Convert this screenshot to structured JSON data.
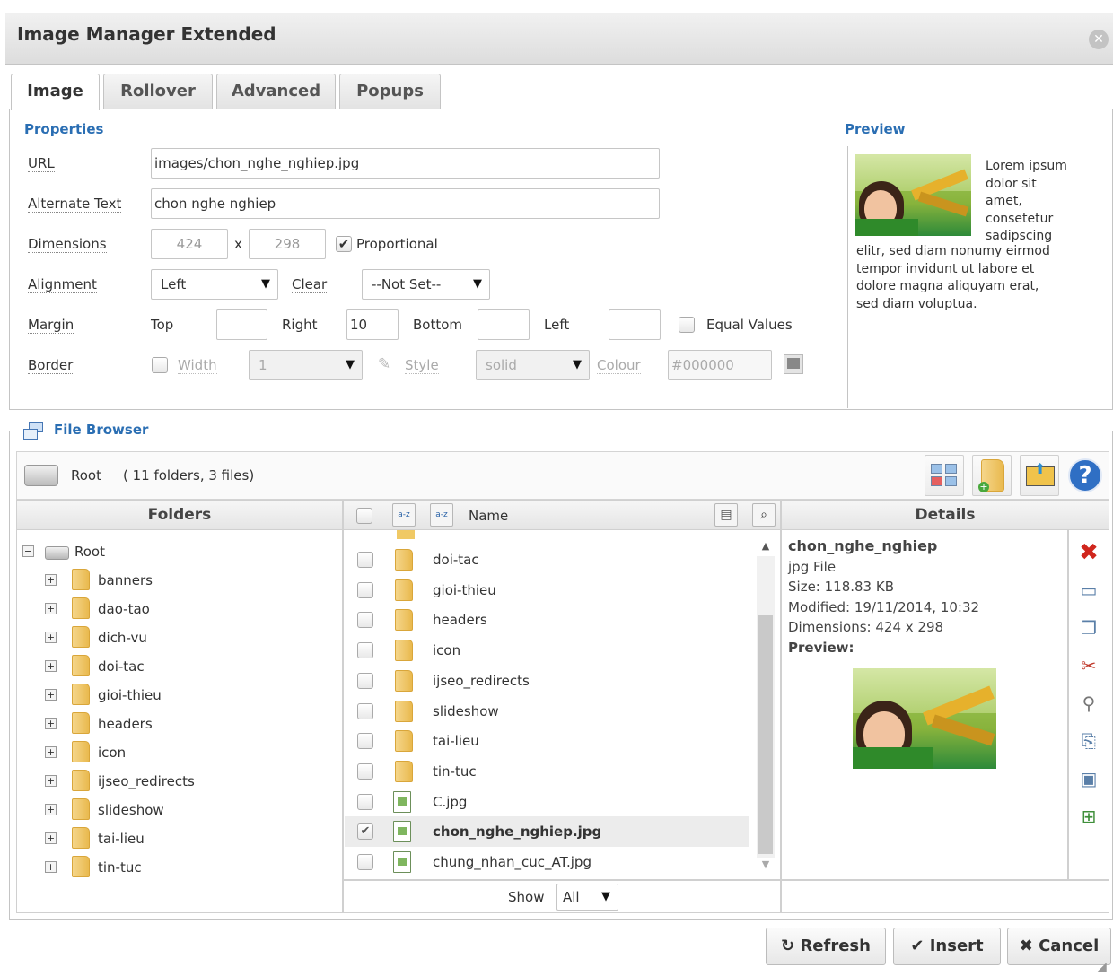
{
  "window": {
    "title": "Image Manager Extended"
  },
  "tabs": [
    "Image",
    "Rollover",
    "Advanced",
    "Popups"
  ],
  "properties": {
    "section_title": "Properties",
    "url_label": "URL",
    "url_value": "images/chon_nghe_nghiep.jpg",
    "alt_label": "Alternate Text",
    "alt_value": "chon nghe nghiep",
    "dimensions_label": "Dimensions",
    "width_value": "424",
    "times_sign": "x",
    "height_value": "298",
    "proportional_label": "Proportional",
    "alignment_label": "Alignment",
    "alignment_value": "Left",
    "clear_label": "Clear",
    "clear_value": "--Not Set--",
    "margin_label": "Margin",
    "margin_top_label": "Top",
    "margin_top_value": "",
    "margin_right_label": "Right",
    "margin_right_value": "10",
    "margin_bottom_label": "Bottom",
    "margin_bottom_value": "",
    "margin_left_label": "Left",
    "margin_left_value": "",
    "equal_values_label": "Equal Values",
    "border_label": "Border",
    "border_width_label": "Width",
    "border_width_value": "1",
    "border_style_label": "Style",
    "border_style_value": "solid",
    "border_colour_label": "Colour",
    "border_colour_value": "#000000"
  },
  "preview": {
    "section_title": "Preview",
    "lorem_short": [
      "Lorem ipsum",
      "dolor sit",
      "amet,",
      "consetetur",
      "sadipscing"
    ],
    "lorem_long": [
      "elitr, sed diam nonumy eirmod",
      "tempor invidunt ut labore et",
      "dolore magna aliquyam erat,",
      "sed diam voluptua."
    ]
  },
  "file_browser": {
    "legend": "File Browser",
    "path_root": "Root",
    "path_summary": "( 11 folders, 3 files)",
    "folders_header": "Folders",
    "name_header": "Name",
    "details_header": "Details",
    "tree_root": "Root",
    "tree_folders": [
      "banners",
      "dao-tao",
      "dich-vu",
      "doi-tac",
      "gioi-thieu",
      "headers",
      "icon",
      "ijseo_redirects",
      "slideshow",
      "tai-lieu",
      "tin-tuc"
    ],
    "list_items": [
      {
        "name": "doi-tac",
        "type": "folder",
        "checked": false
      },
      {
        "name": "gioi-thieu",
        "type": "folder",
        "checked": false
      },
      {
        "name": "headers",
        "type": "folder",
        "checked": false
      },
      {
        "name": "icon",
        "type": "folder",
        "checked": false
      },
      {
        "name": "ijseo_redirects",
        "type": "folder",
        "checked": false
      },
      {
        "name": "slideshow",
        "type": "folder",
        "checked": false
      },
      {
        "name": "tai-lieu",
        "type": "folder",
        "checked": false
      },
      {
        "name": "tin-tuc",
        "type": "folder",
        "checked": false
      },
      {
        "name": "C.jpg",
        "type": "file",
        "checked": false
      },
      {
        "name": "chon_nghe_nghiep.jpg",
        "type": "file",
        "checked": true
      },
      {
        "name": "chung_nhan_cuc_AT.jpg",
        "type": "file",
        "checked": false
      }
    ],
    "show_label": "Show",
    "show_value": "All",
    "details": {
      "name": "chon_nghe_nghiep",
      "type": "jpg File",
      "size": "Size: 118.83 KB",
      "modified": "Modified: 19/11/2014, 10:32",
      "dimensions": "Dimensions: 424 x 298",
      "preview_label": "Preview:"
    }
  },
  "buttons": {
    "refresh": "Refresh",
    "insert": "Insert",
    "cancel": "Cancel"
  },
  "colors": {
    "accent": "#2a6eb3",
    "delete": "#d0261d",
    "help": "#2f6fc4"
  }
}
